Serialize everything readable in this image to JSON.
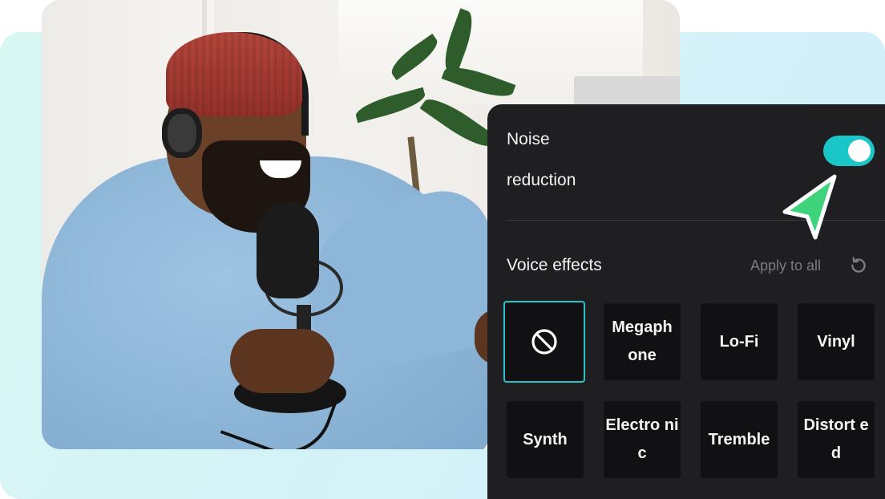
{
  "panel": {
    "noise_reduction": {
      "label_line1": "Noise",
      "label_line2": "reduction",
      "enabled": true
    },
    "voice_effects": {
      "title": "Voice effects",
      "apply_to_all": "Apply to all",
      "reset_icon": "reset-icon",
      "selected": "none",
      "tiles": [
        {
          "label": "",
          "icon": "no-effect-icon"
        },
        {
          "label": "Megaph one"
        },
        {
          "label": "Lo-Fi"
        },
        {
          "label": "Vinyl"
        },
        {
          "label": "Synth"
        },
        {
          "label": "Electro nic"
        },
        {
          "label": "Tremble"
        },
        {
          "label": "Distort ed"
        }
      ]
    },
    "colors": {
      "accent": "#1bc6c9",
      "panel_bg": "#1f1f22",
      "tile_bg": "#111113",
      "cursor": "#3fd47c"
    }
  },
  "background": {
    "photo_subject": "man-with-headphones-and-microphone-photo",
    "cursor_icon": "pointer-cursor-icon"
  }
}
